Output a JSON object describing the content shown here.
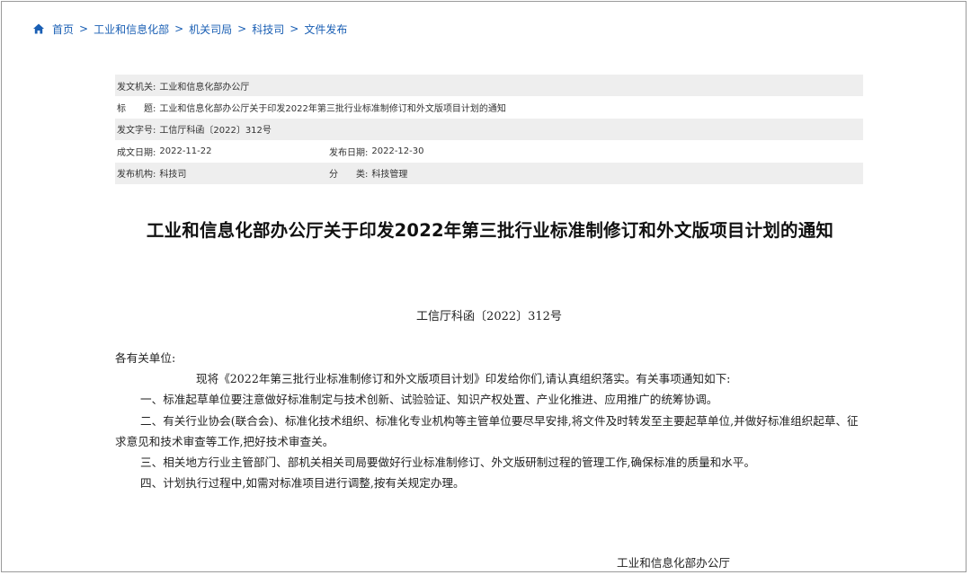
{
  "breadcrumb": {
    "items": [
      "首页",
      "工业和信息化部",
      "机关司局",
      "科技司",
      "文件发布"
    ],
    "separator": ">"
  },
  "meta": {
    "issuer_label": "发文机关:",
    "issuer": "工业和信息化部办公厅",
    "title_label": "标　　题:",
    "title": "工业和信息化部办公厅关于印发2022年第三批行业标准制修订和外文版项目计划的通知",
    "doc_no_label": "发文字号:",
    "doc_no": "工信厅科函〔2022〕312号",
    "written_date_label": "成文日期:",
    "written_date": "2022-11-22",
    "publish_date_label": "发布日期:",
    "publish_date": "2022-12-30",
    "publisher_label": "发布机构:",
    "publisher": "科技司",
    "category_label": "分　　类:",
    "category": "科技管理"
  },
  "document": {
    "title": "工业和信息化部办公厅关于印发2022年第三批行业标准制修订和外文版项目计划的通知",
    "number": "工信厅科函〔2022〕312号",
    "salutation": "各有关单位:",
    "intro": "现将《2022年第三批行业标准制修订和外文版项目计划》印发给你们,请认真组织落实。有关事项通知如下:",
    "items": [
      "一、标准起草单位要注意做好标准制定与技术创新、试验验证、知识产权处置、产业化推进、应用推广的统筹协调。",
      "二、有关行业协会(联合会)、标准化技术组织、标准化专业机构等主管单位要尽早安排,将文件及时转发至主要起草单位,并做好标准组织起草、征求意见和技术审查等工作,把好技术审查关。",
      "三、相关地方行业主管部门、部机关相关司局要做好行业标准制修订、外文版研制过程的管理工作,确保标准的质量和水平。",
      "四、计划执行过程中,如需对标准项目进行调整,按有关规定办理。"
    ],
    "signature": "工业和信息化部办公厅"
  },
  "colors": {
    "link": "#1a5fb4",
    "row_shade": "#eeeeee",
    "frame_border": "#9a9a9a"
  }
}
